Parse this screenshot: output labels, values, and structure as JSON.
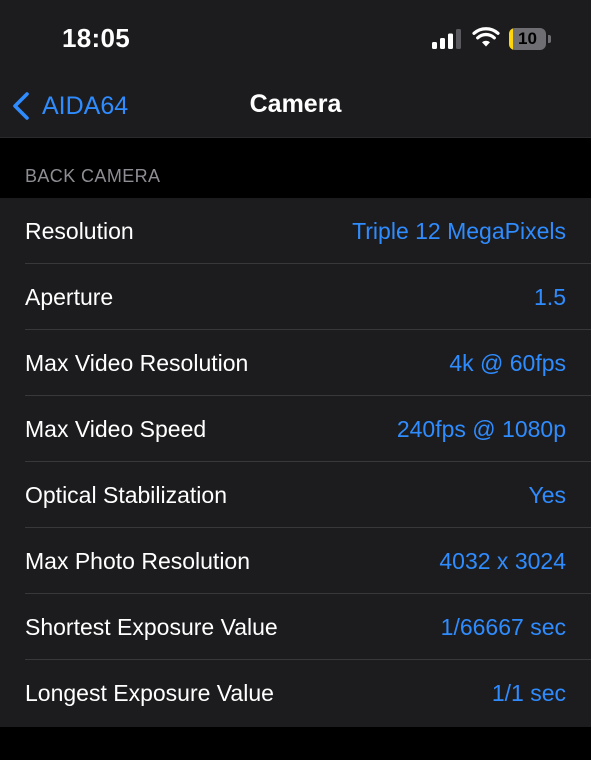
{
  "status_bar": {
    "time": "18:05",
    "battery_level": "10",
    "battery_fraction": 0.1,
    "icons": [
      "cellular-signal-icon",
      "wifi-icon",
      "battery-icon"
    ]
  },
  "nav": {
    "back_label": "AIDA64",
    "title": "Camera"
  },
  "section": {
    "header": "BACK CAMERA",
    "rows": [
      {
        "label": "Resolution",
        "value": "Triple 12 MegaPixels"
      },
      {
        "label": "Aperture",
        "value": "1.5"
      },
      {
        "label": "Max Video Resolution",
        "value": "4k @ 60fps"
      },
      {
        "label": "Max Video Speed",
        "value": "240fps @ 1080p"
      },
      {
        "label": "Optical Stabilization",
        "value": "Yes"
      },
      {
        "label": "Max Photo Resolution",
        "value": "4032 x 3024"
      },
      {
        "label": "Shortest Exposure Value",
        "value": "1/66667 sec"
      },
      {
        "label": "Longest Exposure Value",
        "value": "1/1 sec"
      }
    ]
  },
  "colors": {
    "accent": "#2f8cff",
    "background": "#000000",
    "cell_background": "#1c1c1e",
    "section_header": "#8d8d93",
    "battery_low": "#ffd60a"
  }
}
